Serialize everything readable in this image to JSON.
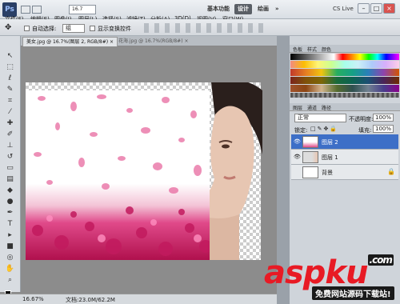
{
  "app": {
    "logo": "Ps",
    "zoom_box": "16.7"
  },
  "menu": [
    "文件(F)",
    "编辑(E)",
    "图像(I)",
    "图层(L)",
    "选择(S)",
    "滤镜(T)",
    "分析(A)",
    "3D(D)",
    "视图(V)",
    "窗口(W)"
  ],
  "workspace": {
    "basic": "基本功能",
    "design": "设计",
    "drawing": "绘画",
    "more": "»",
    "cslive": "CS Live"
  },
  "options": {
    "auto_select": "自动选择:",
    "auto_select_value": "组",
    "transform": "显示变换控件"
  },
  "tabs": [
    {
      "label": "美女.jpg @ 16.7%(图层 2, RGB/8#) ×"
    },
    {
      "label": "花海.jpg @ 16.7%(RGB/8#) ×"
    }
  ],
  "status": {
    "zoom": "16.67%",
    "doc": "文档:23.0M/62.2M"
  },
  "color_panel": {
    "tabs": [
      "色板",
      "样式",
      "颜色"
    ]
  },
  "layers_panel": {
    "tabs": [
      "图层",
      "通道",
      "路径"
    ],
    "blend_mode": "正常",
    "opacity_label": "不透明度:",
    "opacity": "100%",
    "lock_label": "锁定:",
    "fill_label": "填充:",
    "fill": "100%",
    "layers": [
      {
        "name": "图层 2",
        "selected": true
      },
      {
        "name": "图层 1",
        "selected": false
      },
      {
        "name": "背景",
        "selected": false
      }
    ]
  },
  "watermark": {
    "text": "aspku",
    "dotcom": ".com",
    "sub": "免费网站源码下载站!"
  },
  "colors": {
    "accent": "#3d6fc7",
    "watermark": "#e81a24"
  }
}
